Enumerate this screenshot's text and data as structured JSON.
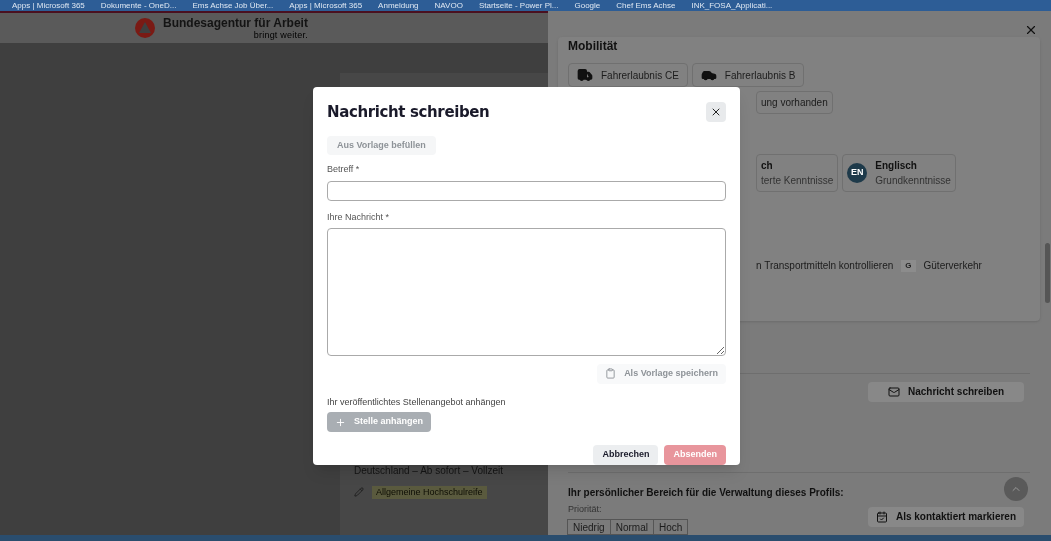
{
  "bookmarks": [
    "Apps | Microsoft 365",
    "Dokumente - OneD...",
    "Ems Achse Job Über...",
    "Apps | Microsoft 365",
    "Anmeldung",
    "NAVOO",
    "Startseite - Power Pl...",
    "Google",
    "Chef Ems Achse",
    "INK_FOSA_Applicati..."
  ],
  "header": {
    "brand": "Bundesagentur für Arbeit",
    "tagline": "bringt weiter."
  },
  "listing": {
    "meta": "Deutschland – Ab sofort – Vollzeit",
    "education": "Allgemeine Hochschulreife"
  },
  "drawer": {
    "section_title": "Mobilität",
    "licenses": [
      {
        "kind": "truck",
        "label": "Fahrerlaubnis CE"
      },
      {
        "kind": "car",
        "label": "Fahrerlaubnis B"
      }
    ],
    "other_chip": "ung vorhanden",
    "languages": [
      {
        "name": "ch",
        "level": "terte Kenntnisse"
      },
      {
        "badge": "EN",
        "name": "Englisch",
        "level": "Grundkenntnisse"
      }
    ],
    "skill_text": "n Transportmitteln kontrollieren",
    "skill_tag": {
      "letter": "G",
      "label": "Güterverkehr"
    },
    "message_button": "Nachricht schreiben",
    "personal_title": "Ihr persönlicher Bereich für die Verwaltung dieses Profils:",
    "priority_label": "Priorität:",
    "priority_options": [
      {
        "label": "Niedrig",
        "selected": false
      },
      {
        "label": "Normal",
        "selected": false
      },
      {
        "label": "Hoch",
        "selected": false
      }
    ],
    "mark_contacted_button": "Als kontaktiert markieren"
  },
  "dialog": {
    "title": "Nachricht schreiben",
    "template_button": {
      "label": "Aus Vorlage befüllen",
      "disabled": true
    },
    "subject": {
      "label": "Betreff *"
    },
    "message": {
      "label": "Ihre Nachricht *"
    },
    "save_template": {
      "label": "Als Vorlage speichern",
      "disabled": true
    },
    "attach_label": "Ihr veröffentlichtes Stellenangebot anhängen",
    "attach_button": {
      "label": "Stelle anhängen",
      "disabled": true
    },
    "cancel": "Abbrechen",
    "send": {
      "label": "Absenden",
      "disabled": true
    }
  }
}
